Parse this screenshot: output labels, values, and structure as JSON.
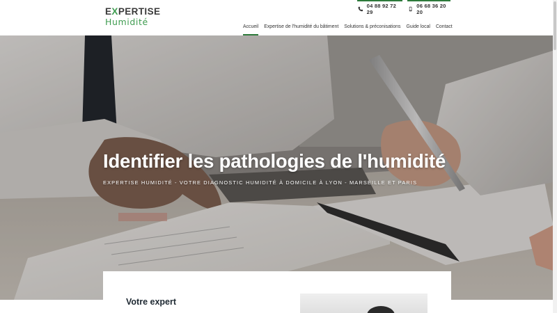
{
  "header": {
    "logo": {
      "line1_first": "E",
      "line1_x": "X",
      "line1_rest": "PERTISE",
      "line2": "Humidité"
    },
    "phone_1": {
      "icon": "phone-icon",
      "number": "04 88 92 72 29"
    },
    "phone_2": {
      "icon": "mobile-phone-icon",
      "number": "06 68 36 20 20"
    },
    "nav": [
      {
        "label": "Accueil",
        "active": true
      },
      {
        "label": "Expertise de l'humidité du bâtiment",
        "active": false
      },
      {
        "label": "Solutions & préconisations",
        "active": false
      },
      {
        "label": "Guide local",
        "active": false
      },
      {
        "label": "Contact",
        "active": false
      }
    ]
  },
  "hero": {
    "title": "Identifier les pathologies de l'humidité",
    "subtitle": "EXPERTISE HUMIDITÉ - VOTRE DIAGNOSTIC HUMIDITÉ À DOMICILE À LYON - MARSEILLE ET PARIS"
  },
  "content": {
    "section_heading": "Votre expert"
  },
  "colors": {
    "accent_green": "#2d7a3a",
    "logo_green": "#3f9c50",
    "text_dark": "#333333",
    "hero_text": "#ffffff"
  }
}
